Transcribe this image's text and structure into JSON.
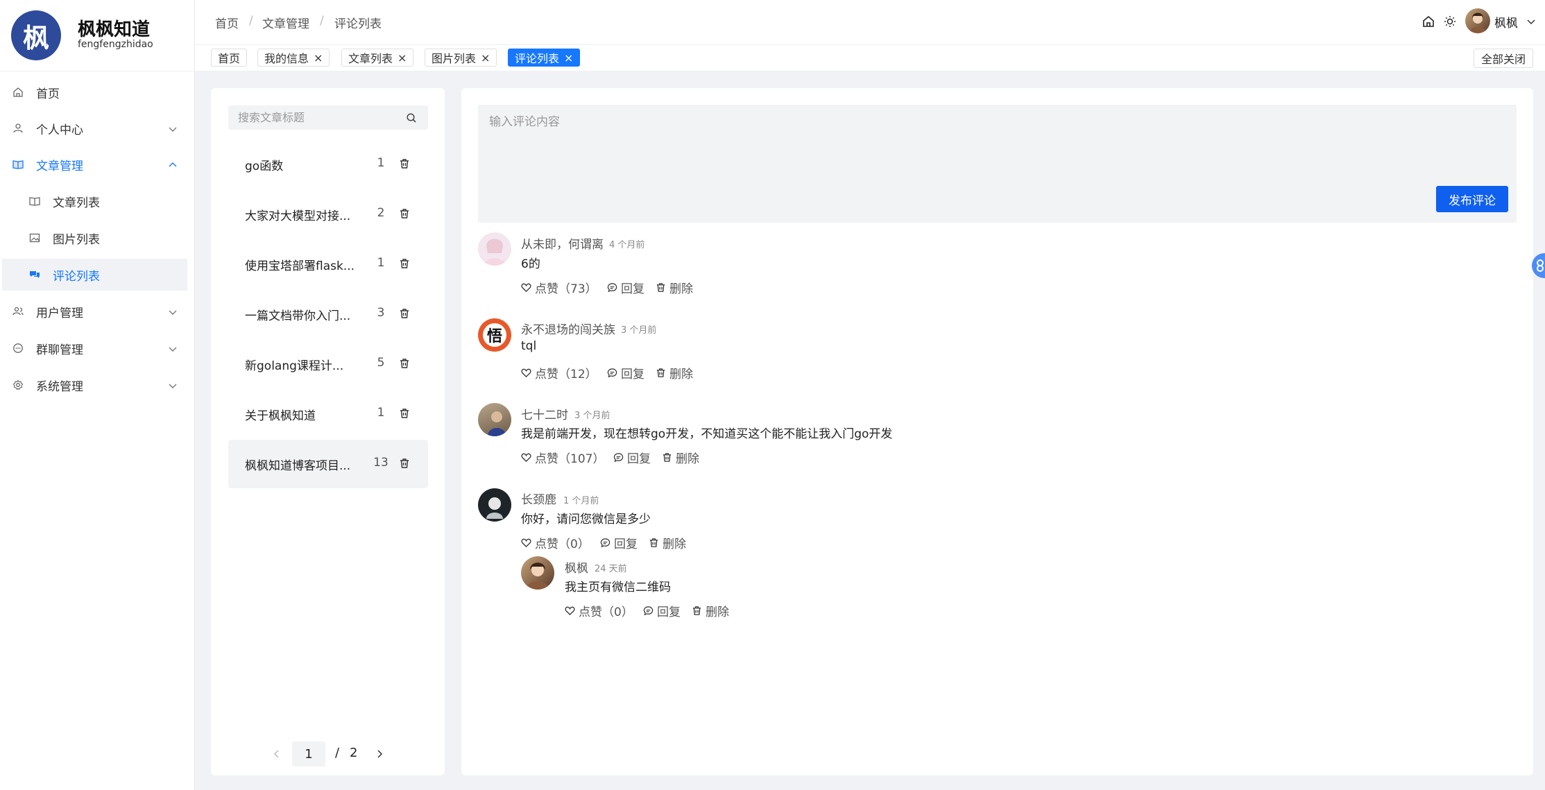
{
  "brand": {
    "logo_char": "枫",
    "title": "枫枫知道",
    "subtitle": "fengfengzhidao"
  },
  "sidebar": {
    "items": [
      {
        "label": "首页"
      },
      {
        "label": "个人中心"
      },
      {
        "label": "文章管理"
      },
      {
        "label": "文章列表"
      },
      {
        "label": "图片列表"
      },
      {
        "label": "评论列表"
      },
      {
        "label": "用户管理"
      },
      {
        "label": "群聊管理"
      },
      {
        "label": "系统管理"
      }
    ]
  },
  "header": {
    "breadcrumb": [
      "首页",
      "文章管理",
      "评论列表"
    ],
    "separator": "/",
    "user_name": "枫枫"
  },
  "tabs": [
    {
      "label": "首页"
    },
    {
      "label": "我的信息"
    },
    {
      "label": "文章列表"
    },
    {
      "label": "图片列表"
    },
    {
      "label": "评论列表"
    }
  ],
  "tab_close_glyph": "×",
  "close_all_label": "全部关闭",
  "article_panel": {
    "search_placeholder": "搜索文章标题",
    "articles": [
      {
        "title": "go函数",
        "count": "1"
      },
      {
        "title": "大家对大模型对接...",
        "count": "2"
      },
      {
        "title": "使用宝塔部署flask...",
        "count": "1"
      },
      {
        "title": "一篇文档带你入门...",
        "count": "3"
      },
      {
        "title": "新golang课程计...",
        "count": "5"
      },
      {
        "title": "关于枫枫知道",
        "count": "1"
      },
      {
        "title": "枫枫知道博客项目...",
        "count": "13"
      }
    ],
    "pager": {
      "current": "1",
      "separator": "/",
      "total": "2"
    }
  },
  "comment_panel": {
    "input_placeholder": "输入评论内容",
    "publish_label": "发布评论",
    "actions": {
      "like": "点赞",
      "reply": "回复",
      "delete": "删除"
    },
    "comments": [
      {
        "name": "从未即，何谓离",
        "time": "4 个月前",
        "text": "6的",
        "likes": "（73）",
        "avatar": "anime-girl-avatar"
      },
      {
        "name": "永不退场的闯关族",
        "time": "3 个月前",
        "text": "tql",
        "likes": "（12）",
        "avatar": "wu-kanji-avatar",
        "avatar_char": "悟"
      },
      {
        "name": "七十二时",
        "time": "3 个月前",
        "text": "我是前端开发，现在想转go开发，不知道买这个能不能让我入门go开发",
        "likes": "（107）",
        "avatar": "photo-avatar"
      },
      {
        "name": "长颈鹿",
        "time": "1 个月前",
        "text": "你好，请问您微信是多少",
        "likes": "（0）",
        "avatar": "dark-avatar"
      }
    ],
    "reply": {
      "name": "枫枫",
      "time": "24 天前",
      "text": "我主页有微信二维码",
      "likes": "（0）",
      "avatar": "user-avatar"
    }
  },
  "colors": {
    "accent": "#1677ff",
    "button": "#1060ef",
    "logo_bg": "#2d4a9b"
  }
}
